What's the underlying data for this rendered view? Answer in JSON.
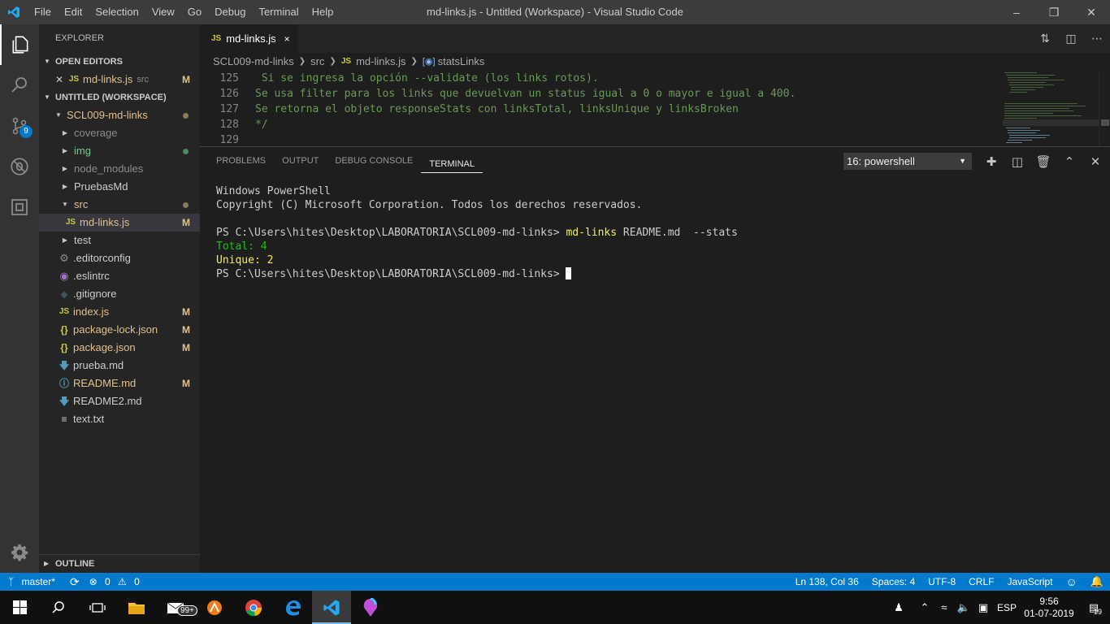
{
  "window": {
    "title": "md-links.js - Untitled (Workspace) - Visual Studio Code",
    "menu": [
      "File",
      "Edit",
      "Selection",
      "View",
      "Go",
      "Debug",
      "Terminal",
      "Help"
    ]
  },
  "activity": {
    "scm_badge": "9"
  },
  "sidebar": {
    "title": "EXPLORER",
    "open_editors_header": "OPEN EDITORS",
    "open_editor": {
      "name": "md-links.js",
      "folder": "src",
      "status": "M"
    },
    "workspace_header": "UNTITLED (WORKSPACE)",
    "root": "SCL009-md-links",
    "tree": [
      {
        "name": "coverage",
        "type": "folder"
      },
      {
        "name": "img",
        "type": "folder"
      },
      {
        "name": "node_modules",
        "type": "folder"
      },
      {
        "name": "PruebasMd",
        "type": "folder"
      },
      {
        "name": "src",
        "type": "folder-open"
      },
      {
        "name": "md-links.js",
        "type": "file",
        "status": "M"
      },
      {
        "name": "test",
        "type": "folder"
      },
      {
        "name": ".editorconfig",
        "type": "file"
      },
      {
        "name": ".eslintrc",
        "type": "file"
      },
      {
        "name": ".gitignore",
        "type": "file"
      },
      {
        "name": "index.js",
        "type": "file",
        "status": "M"
      },
      {
        "name": "package-lock.json",
        "type": "file",
        "status": "M"
      },
      {
        "name": "package.json",
        "type": "file",
        "status": "M"
      },
      {
        "name": "prueba.md",
        "type": "file"
      },
      {
        "name": "README.md",
        "type": "file",
        "status": "M"
      },
      {
        "name": "README2.md",
        "type": "file"
      },
      {
        "name": "text.txt",
        "type": "file"
      }
    ],
    "outline_header": "OUTLINE"
  },
  "editor": {
    "tab": {
      "label": "md-links.js",
      "lang_badge": "JS",
      "close": "×"
    },
    "breadcrumb": [
      "SCL009-md-links",
      "src",
      "md-links.js",
      "statsLinks"
    ],
    "lines": [
      {
        "num": "125",
        "text": " Si se ingresa la opción --validate (los links rotos)."
      },
      {
        "num": "126",
        "text": "Se usa filter para los links que devuelvan un status igual a 0 o mayor e igual a 400."
      },
      {
        "num": "127",
        "text": "Se retorna el objeto responseStats con linksTotal, linksUnique y linksBroken"
      },
      {
        "num": "128",
        "text": "*/"
      },
      {
        "num": "129",
        "text": ""
      }
    ]
  },
  "panel": {
    "tabs": [
      "PROBLEMS",
      "OUTPUT",
      "DEBUG CONSOLE",
      "TERMINAL"
    ],
    "active_tab": "TERMINAL",
    "terminal_select": "16: powershell",
    "terminal": {
      "line1": "Windows PowerShell",
      "line2": "Copyright (C) Microsoft Corporation. Todos los derechos reservados.",
      "prompt": "PS C:\\Users\\hites\\Desktop\\LABORATORIA\\SCL009-md-links>",
      "cmd": "md-links",
      "args": "README.md  --stats",
      "total": "Total: 4",
      "unique": "Unique: 2"
    }
  },
  "status": {
    "branch": "master*",
    "errors": "0",
    "warnings": "0",
    "position": "Ln 138, Col 36",
    "spaces": "Spaces: 4",
    "encoding": "UTF-8",
    "eol": "CRLF",
    "language": "JavaScript"
  },
  "taskbar": {
    "mail_badge": "99+",
    "lang": "ESP",
    "time": "9:56",
    "date": "01-07-2019",
    "notif_count": "19"
  },
  "colors": {
    "accent": "#007acc",
    "modified": "#e2c08d",
    "comment": "#6a9955",
    "terminal_green": "#16c60c",
    "terminal_yellow": "#f1f147"
  }
}
